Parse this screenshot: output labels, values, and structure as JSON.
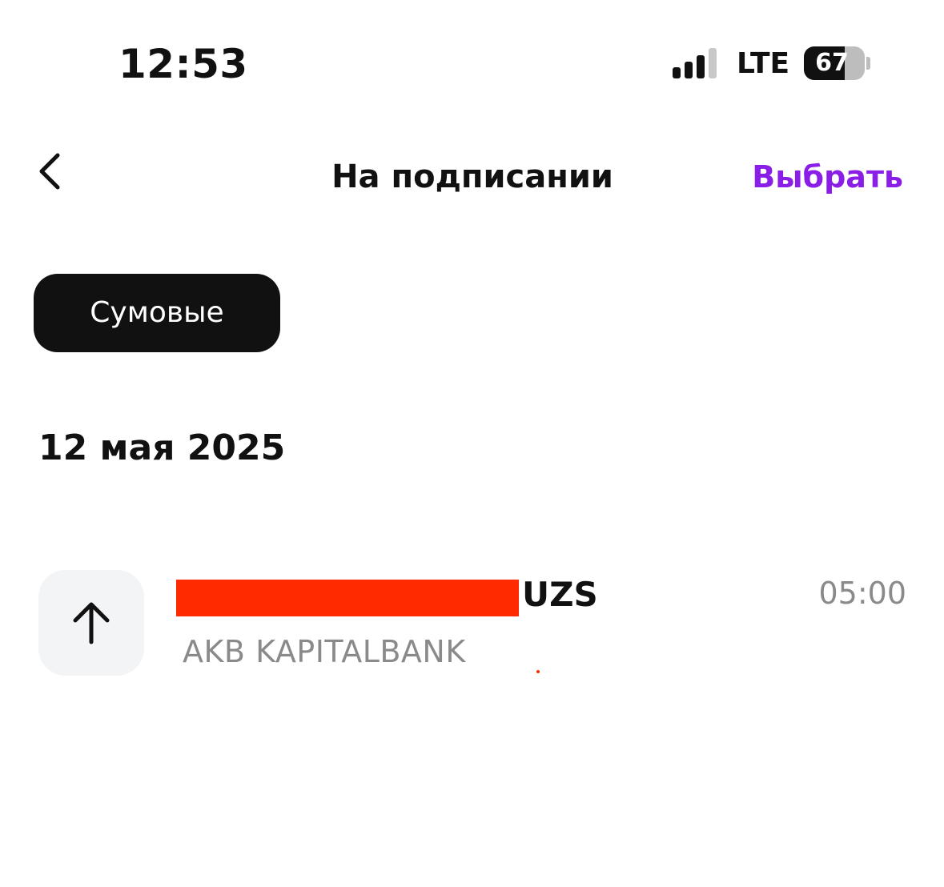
{
  "status_bar": {
    "time": "12:53",
    "network": "LTE",
    "battery_level": "67",
    "battery_percent": 67,
    "signal_bars_active": 3,
    "signal_bars_total": 4
  },
  "nav": {
    "back_icon": "chevron-left-icon",
    "title": "На подписании",
    "action_label": "Выбрать",
    "action_color": "#8a1de6"
  },
  "filters": {
    "active_chip": "Сумовые"
  },
  "sections": [
    {
      "date": "12 мая 2025",
      "transactions": [
        {
          "icon": "arrow-up-icon",
          "amount_redacted": true,
          "currency": "UZS",
          "bank": "AKB KAPITALBANK",
          "time": "05:00"
        }
      ]
    }
  ]
}
